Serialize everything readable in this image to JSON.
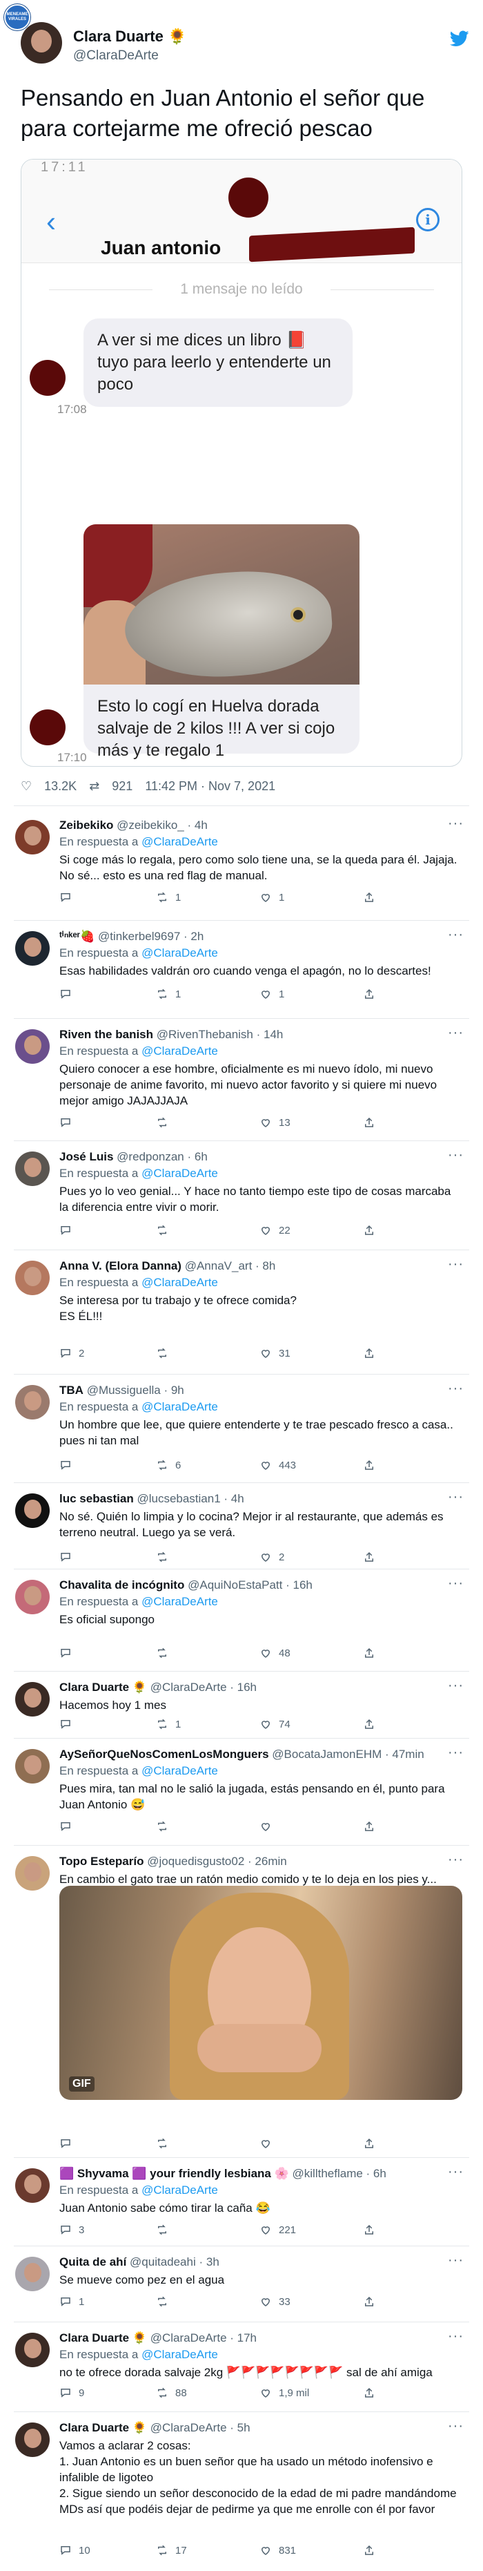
{
  "badge": "MENEAME VIRALES",
  "tweet": {
    "author_name": "Clara Duarte 🌻",
    "author_handle": "@ClaraDeArte",
    "text": "Pensando en Juan Antonio el señor que para cortejarme me ofreció pescao",
    "meta": {
      "likes": "13.2K",
      "retweets": "921",
      "time": "11:42 PM · Nov 7, 2021"
    }
  },
  "dm": {
    "status_time": "17:11",
    "back_icon": "chevron-left-icon",
    "contact_name": "Juan antonio",
    "info_icon": "i",
    "unread": "1 mensaje no leído",
    "msg1": "A ver si me dices un libro 📕 tuyo para leerlo y entenderte un poco",
    "msg1_time": "17:08",
    "msg2": "Esto lo cogí en Huelva dorada salvaje de 2 kilos !!! A ver si cojo más y te regalo 1",
    "msg2_time": "17:10"
  },
  "replies": [
    {
      "name": "Zeibekiko",
      "handle": "@zeibekiko_",
      "time": "· 4h",
      "reply_to": "@ClaraDeArte",
      "text": "Si coge más lo regala, pero como solo tiene una, se la queda para él. Jajaja. No sé... esto es una red flag de manual.",
      "replies": "",
      "retweets": "1",
      "likes": "1",
      "avatar": "#7d3b2a"
    },
    {
      "name": "ᵗⁱⁿᵏᵉʳ🍓",
      "handle": "@tinkerbel9697",
      "time": "· 2h",
      "reply_to": "@ClaraDeArte",
      "text": "Esas habilidades valdrán oro cuando venga el apagón, no lo descartes!",
      "replies": "",
      "retweets": "1",
      "likes": "1",
      "avatar": "#1d2630"
    },
    {
      "name": "Riven the banish",
      "handle": "@RivenThebanish",
      "time": "· 14h",
      "reply_to": "@ClaraDeArte",
      "text": "Quiero conocer a ese hombre, oficialmente es mi nuevo ídolo, mi nuevo personaje de anime favorito, mi nuevo actor favorito y si  quiere mi nuevo mejor amigo JAJAJJAJA",
      "replies": "",
      "retweets": "",
      "likes": "13",
      "avatar": "#6b4f8c"
    },
    {
      "name": "José Luis",
      "handle": "@redponzan",
      "time": "· 6h",
      "reply_to": "@ClaraDeArte",
      "text": "Pues yo lo veo genial... Y hace no tanto tiempo este tipo de cosas marcaba la diferencia entre vivir o morir.",
      "replies": "",
      "retweets": "",
      "likes": "22",
      "avatar": "#5a5550"
    },
    {
      "name": "Anna V. (Elora Danna)",
      "handle": "@AnnaV_art",
      "time": "· 8h",
      "reply_to": "@ClaraDeArte",
      "text": "Se interesa por tu trabajo y te ofrece comida?\nES ÉL!!!",
      "replies": "2",
      "retweets": "",
      "likes": "31",
      "avatar": "#b5785f"
    },
    {
      "name": "TBA",
      "handle": "@Mussiguella",
      "time": "· 9h",
      "reply_to": "@ClaraDeArte",
      "text": "Un hombre que lee, que quiere entenderte y te trae pescado fresco a casa.. pues ni tan mal",
      "replies": "",
      "retweets": "6",
      "likes": "443",
      "avatar": "#9a7a6d"
    },
    {
      "name": "luc sebastian",
      "handle": "@lucsebastian1",
      "time": "· 4h",
      "reply_to": "",
      "text": "No sé. Quién lo limpia y lo cocina? Mejor ir al restaurante, que además es terreno neutral. Luego ya se verá.",
      "replies": "",
      "retweets": "",
      "likes": "2",
      "avatar": "#111111"
    },
    {
      "name": "Chavalita de incógnito",
      "handle": "@AquiNoEstaPatt",
      "time": "· 16h",
      "reply_to": "@ClaraDeArte",
      "text": "Es oficial supongo",
      "replies": "",
      "retweets": "",
      "likes": "48",
      "avatar": "#c46a78"
    },
    {
      "name": "Clara Duarte 🌻",
      "handle": "@ClaraDeArte",
      "time": "· 16h",
      "reply_to": "",
      "text": "Hacemos hoy 1 mes",
      "replies": "",
      "retweets": "1",
      "likes": "74",
      "avatar": "#3a2a24"
    },
    {
      "name": "AySeñorQueNosComenLosMonguers",
      "handle": "@BocataJamonEHM",
      "time": "· 47min",
      "reply_to": "@ClaraDeArte",
      "text": "Pues mira, tan mal no le salió la jugada, estás pensando en él, punto para Juan Antonio 😅",
      "replies": "",
      "retweets": "",
      "likes": "",
      "avatar": "#8f6e52"
    },
    {
      "name": "Topo Esteparío",
      "handle": "@joquedisgusto02",
      "time": "· 26min",
      "reply_to": "",
      "text": "En cambio el gato trae un ratón medio comido y te lo deja en los pies y...",
      "replies": "",
      "retweets": "",
      "likes": "",
      "avatar": "#c9a37b",
      "gif_label": "GIF"
    },
    {
      "name": "🟪 Shyvama 🟪 your friendly lesbiana 🌸",
      "handle": "@killtheflame",
      "time": "· 6h",
      "reply_to": "@ClaraDeArte",
      "text": "Juan Antonio sabe cómo tirar la caña 😂",
      "replies": "3",
      "retweets": "",
      "likes": "221",
      "avatar": "#6a3a2e"
    },
    {
      "name": "Quita de ahí",
      "handle": "@quitadeahi",
      "time": "· 3h",
      "reply_to": "",
      "text": "Se mueve como pez en el agua",
      "replies": "1",
      "retweets": "",
      "likes": "33",
      "avatar": "#a9a6ad"
    },
    {
      "name": "Clara Duarte 🌻",
      "handle": "@ClaraDeArte",
      "time": "· 17h",
      "reply_to": "@ClaraDeArte",
      "text": "no te ofrece dorada salvaje 2kg 🚩🚩🚩🚩🚩🚩🚩🚩 sal de ahí amiga",
      "replies": "9",
      "retweets": "88",
      "likes": "1,9 mil",
      "avatar": "#3a2a24"
    },
    {
      "name": "Clara Duarte 🌻",
      "handle": "@ClaraDeArte",
      "time": "· 5h",
      "reply_to": "",
      "text": "Vamos a aclarar 2 cosas:\n1. Juan Antonio es un buen señor que ha usado un método inofensivo e infalible de ligoteo\n2. Sigue siendo un señor desconocido de la edad de mi padre mandándome MDs así que podéis dejar de pedirme ya que me enrolle con él por favor",
      "replies": "10",
      "retweets": "17",
      "likes": "831",
      "avatar": "#3a2a24"
    }
  ],
  "labels": {
    "in_reply_to": "En respuesta a",
    "more": "···"
  }
}
